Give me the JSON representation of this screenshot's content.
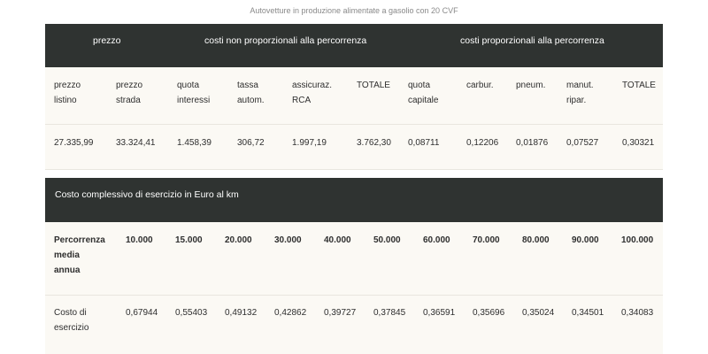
{
  "caption": "Autovetture in produzione alimentate a gasolio con 20 CVF",
  "table1": {
    "group_headers": {
      "price": "prezzo",
      "non_proportional": "costi non proporzionali alla percorrenza",
      "proportional": "costi proporzionali alla percorrenza"
    },
    "columns": [
      {
        "line1": "prezzo",
        "line2": "listino"
      },
      {
        "line1": "prezzo",
        "line2": "strada"
      },
      {
        "line1": "quota",
        "line2": "interessi"
      },
      {
        "line1": "tassa",
        "line2": "autom."
      },
      {
        "line1": "assicuraz.",
        "line2": "RCA"
      },
      {
        "line1": "TOTALE",
        "line2": ""
      },
      {
        "line1": "quota",
        "line2": "capitale"
      },
      {
        "line1": "carbur.",
        "line2": ""
      },
      {
        "line1": "pneum.",
        "line2": ""
      },
      {
        "line1": "manut.",
        "line2": "ripar."
      },
      {
        "line1": "TOTALE",
        "line2": ""
      }
    ],
    "values": [
      "27.335,99",
      "33.324,41",
      "1.458,39",
      "306,72",
      "1.997,19",
      "3.762,30",
      "0,08711",
      "0,12206",
      "0,01876",
      "0,07527",
      "0,30321"
    ]
  },
  "table2": {
    "title": "Costo complessivo di esercizio in Euro al km",
    "row1_label": {
      "line1": "Percorrenza",
      "line2": "media",
      "line3": "annua"
    },
    "distances": [
      "10.000",
      "15.000",
      "20.000",
      "30.000",
      "40.000",
      "50.000",
      "60.000",
      "70.000",
      "80.000",
      "90.000",
      "100.000"
    ],
    "row2_label": {
      "line1": "Costo di",
      "line2": "esercizio"
    },
    "costs": [
      "0,67944",
      "0,55403",
      "0,49132",
      "0,42862",
      "0,39727",
      "0,37845",
      "0,36591",
      "0,35696",
      "0,35024",
      "0,34501",
      "0,34083"
    ]
  }
}
